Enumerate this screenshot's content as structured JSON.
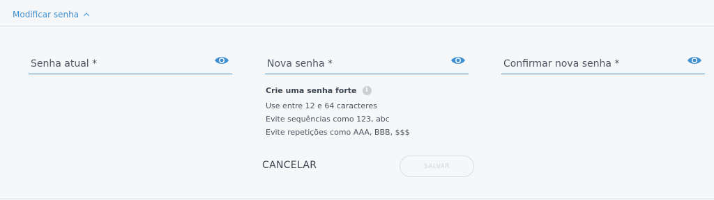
{
  "section": {
    "title": "Modificar senha",
    "expanded": true
  },
  "fields": {
    "current_password": {
      "placeholder": "Senha atual *",
      "value": ""
    },
    "new_password": {
      "placeholder": "Nova senha *",
      "value": ""
    },
    "confirm_password": {
      "placeholder": "Confirmar nova senha *",
      "value": ""
    }
  },
  "hint": {
    "title": "Crie uma senha forte",
    "lines": [
      "Use entre 12 e 64 caracteres",
      "Evite sequências como 123, abc",
      "Evite repetições como AAA, BBB, $$$"
    ]
  },
  "actions": {
    "cancel_label": "CANCELAR",
    "save_label": "SALVAR",
    "save_enabled": false
  },
  "colors": {
    "accent": "#3f8fd1",
    "background": "#f5f7f9",
    "disabled": "#d0d5da"
  },
  "icons": {
    "toggle": "chevron-up-icon",
    "show_password": "eye-icon",
    "info": "info-icon"
  }
}
